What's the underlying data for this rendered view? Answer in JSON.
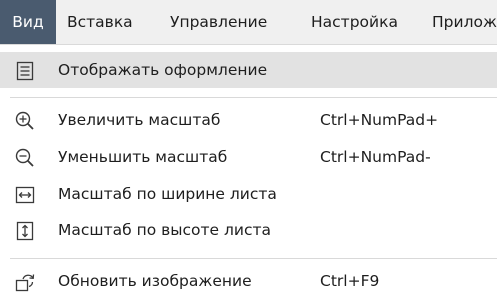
{
  "menubar": {
    "items": [
      {
        "label": "Вид",
        "active": true
      },
      {
        "label": "Вставка"
      },
      {
        "label": "Управление"
      },
      {
        "label": "Настройка"
      },
      {
        "label": "Прилож"
      }
    ]
  },
  "menu": {
    "items": [
      {
        "label": "Отображать оформление",
        "shortcut": "",
        "icon": "form-view-icon"
      },
      {
        "label": "Увеличить масштаб",
        "shortcut": "Ctrl+NumPad+",
        "icon": "zoom-in-icon"
      },
      {
        "label": "Уменьшить масштаб",
        "shortcut": "Ctrl+NumPad-",
        "icon": "zoom-out-icon"
      },
      {
        "label": "Масштаб по ширине листа",
        "shortcut": "",
        "icon": "fit-width-icon"
      },
      {
        "label": "Масштаб по высоте листа",
        "shortcut": "",
        "icon": "fit-height-icon"
      },
      {
        "label": "Обновить изображение",
        "shortcut": "Ctrl+F9",
        "icon": "refresh-image-icon"
      }
    ]
  },
  "colors": {
    "menubar_bg": "#f0f0f0",
    "active_tab_bg": "#4a5b6f",
    "highlight_row": "#e2e2e2",
    "icon_stroke": "#3a3a3a"
  }
}
